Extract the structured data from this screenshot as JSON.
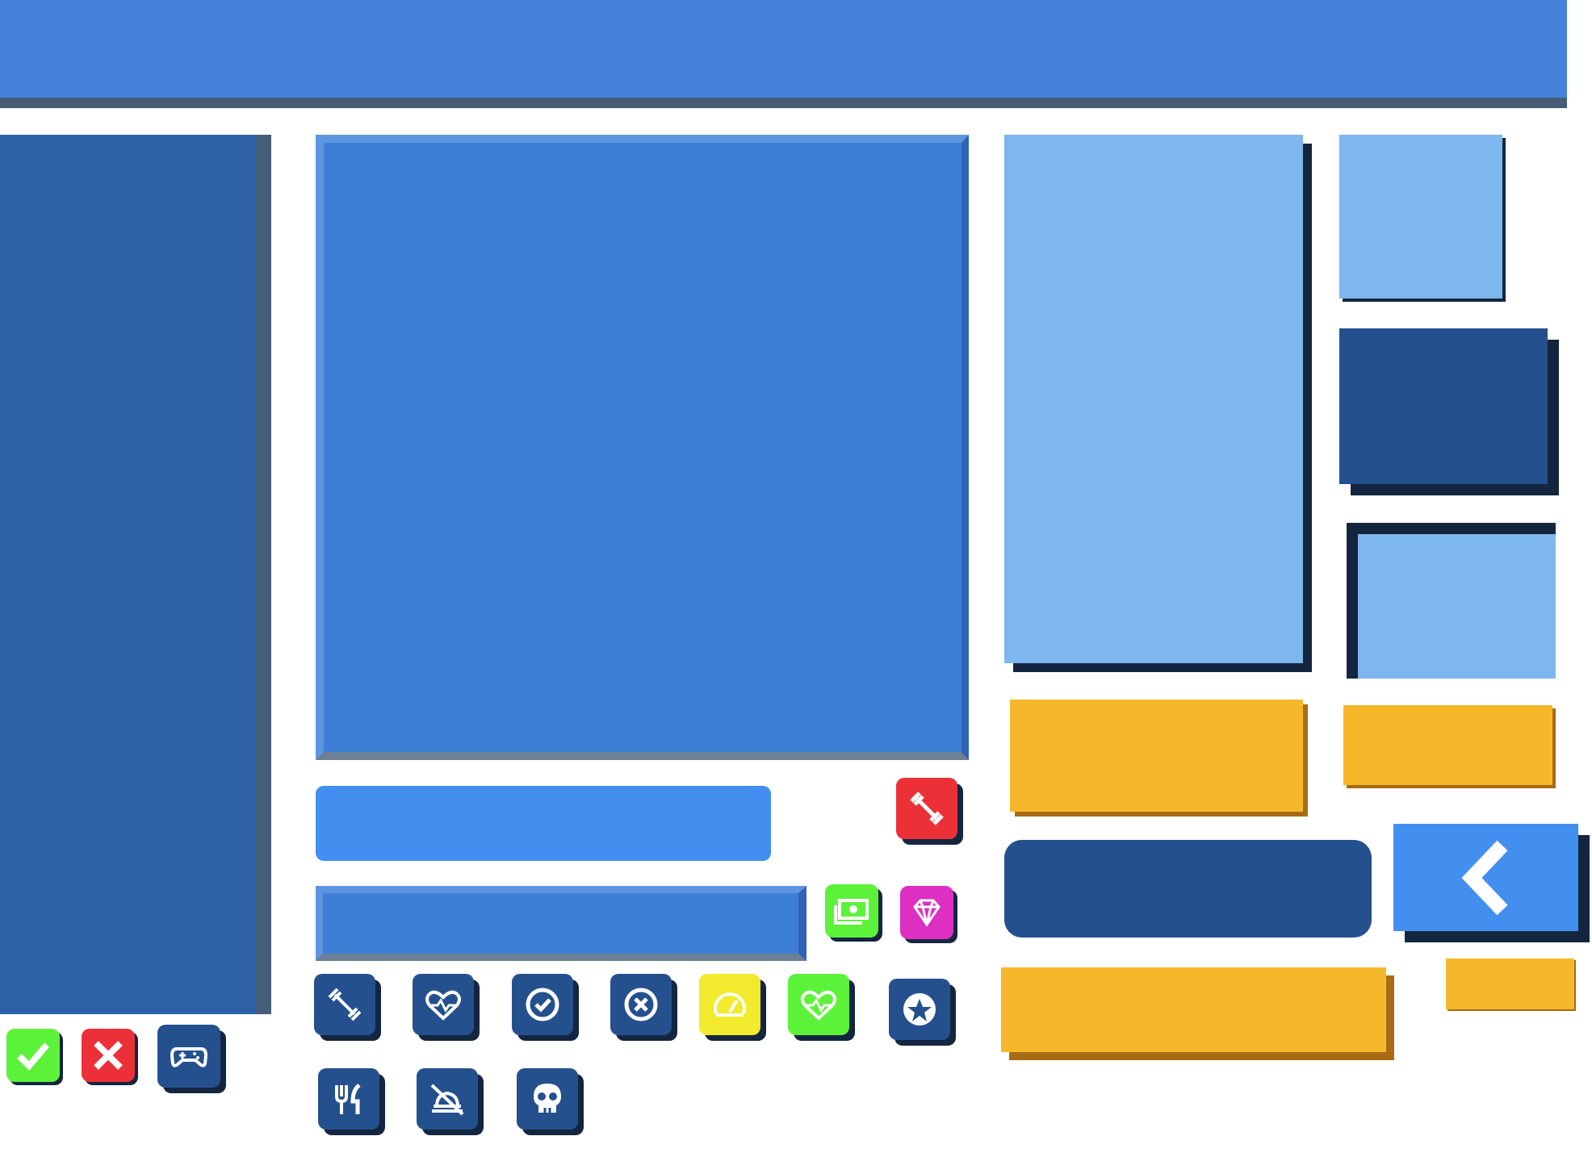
{
  "colors": {
    "top_bar": "#4482d9",
    "panel_blue": "#3e7fd6",
    "panel_light": "#7eb6ee",
    "panel_dark": "#24508e",
    "button_blue": "#428ff0",
    "button_yellow": "#f6b82b",
    "shadow": "#14263f",
    "success": "#5cf23a",
    "danger": "#ec3038",
    "gem": "#dd30c3",
    "speed": "#f2ea2c"
  },
  "icons": {
    "row_left": [
      "check-icon",
      "close-icon",
      "gamepad-icon"
    ],
    "middle_top": [
      "dumbbell-icon"
    ],
    "middle_side": [
      "money-icon",
      "diamond-icon"
    ],
    "row_main": [
      "dumbbell-icon",
      "heart-rate-icon",
      "check-circle-icon",
      "close-circle-icon",
      "speedometer-icon",
      "heart-rate-icon",
      "star-icon"
    ],
    "row_bottom": [
      "food-icon",
      "no-food-icon",
      "skull-icon"
    ],
    "back": "chevron-left-icon"
  }
}
